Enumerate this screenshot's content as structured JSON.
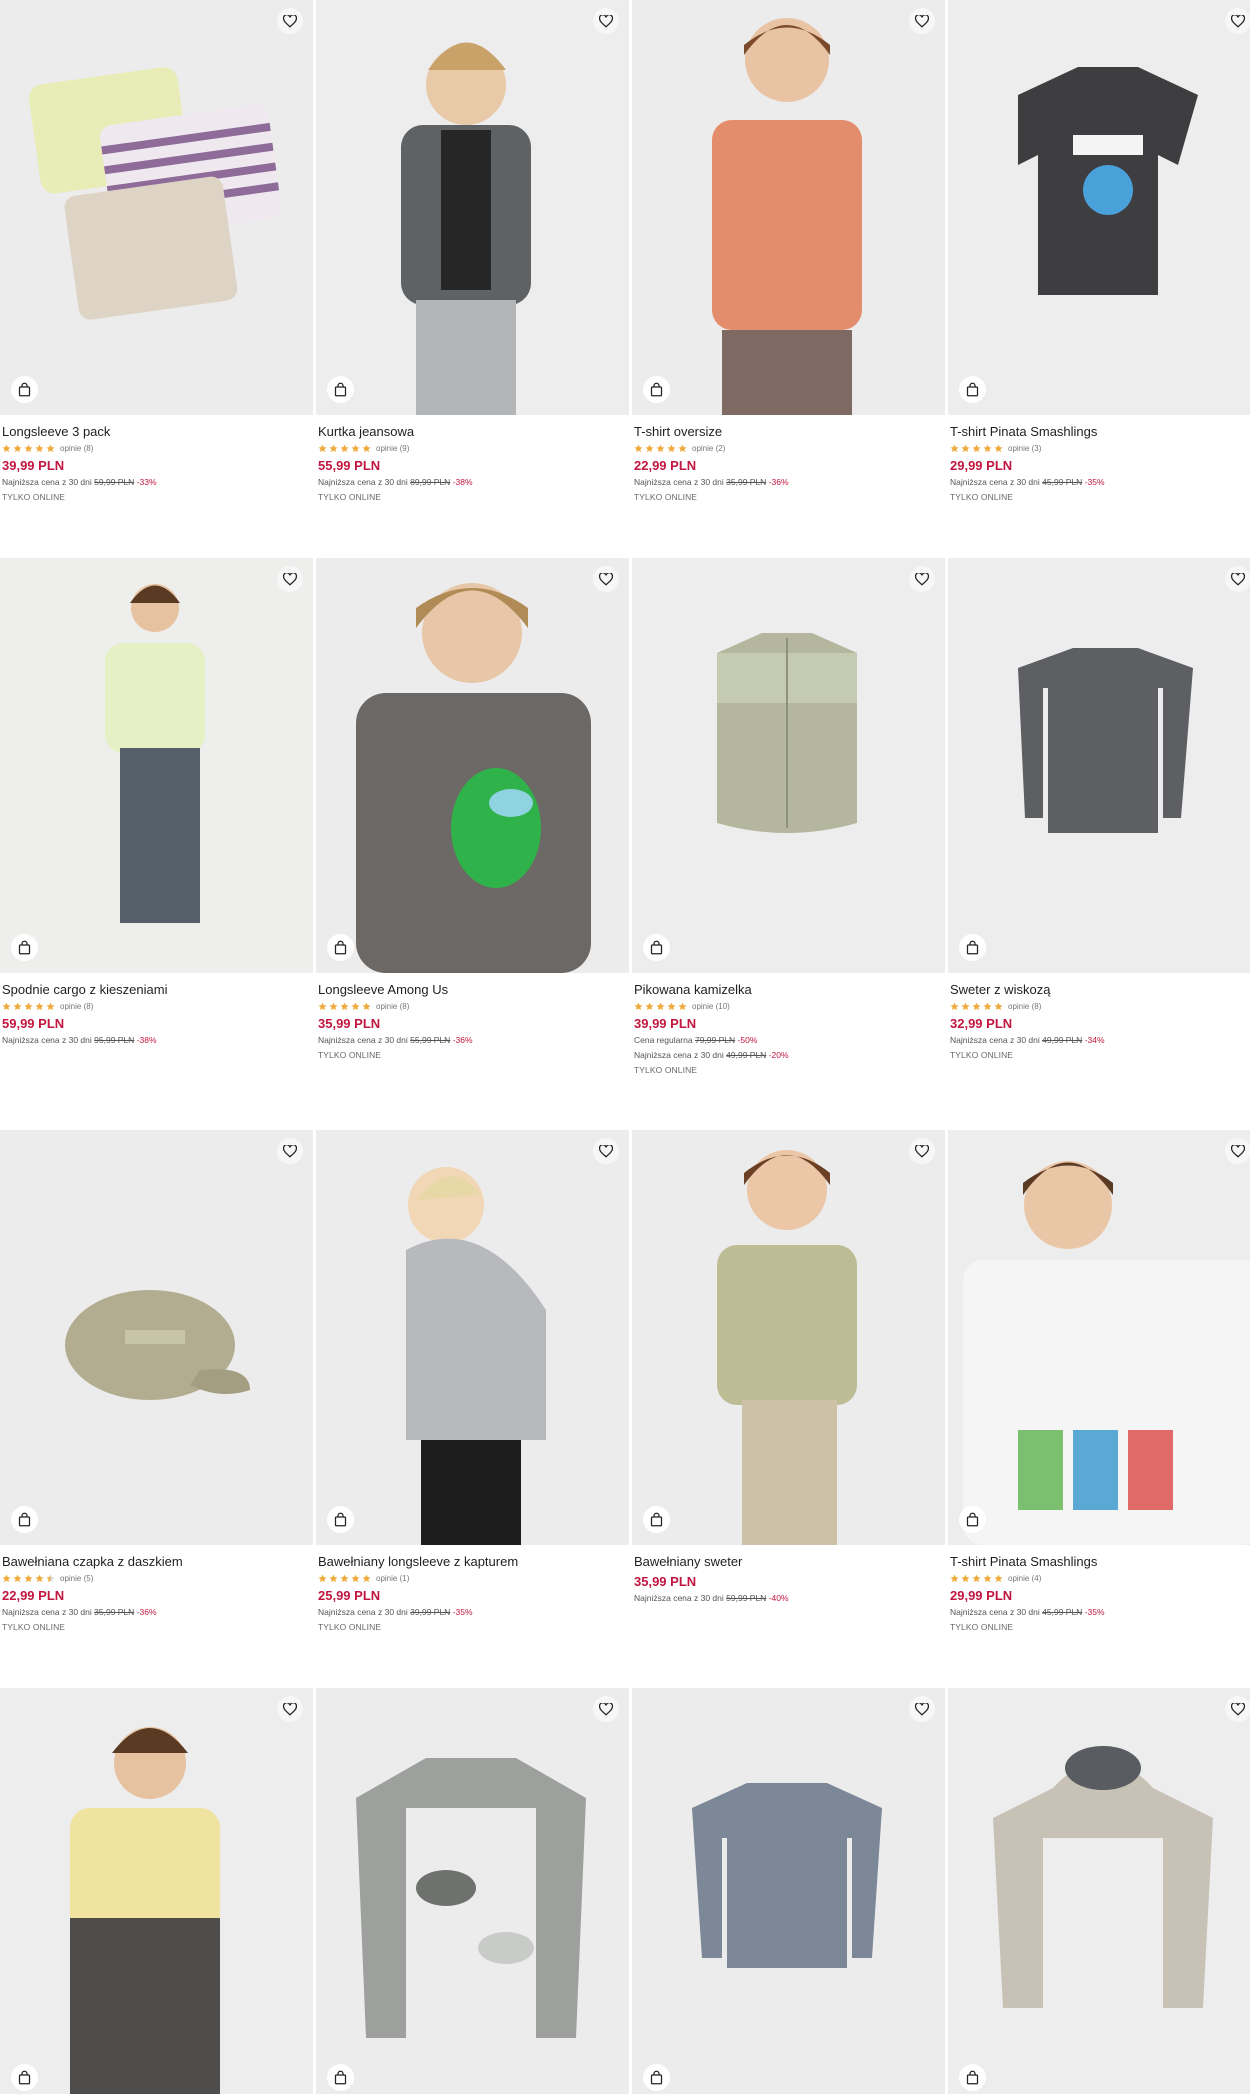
{
  "colors": {
    "price": "#c1163f",
    "star": "#f0a93c",
    "image_bg": "#ededed"
  },
  "icons": {
    "favorite": "heart-icon",
    "add_to_cart": "shopping-bag-icon",
    "rating": "star-icon"
  },
  "products": [
    {
      "name": "Longsleeve 3 pack",
      "stars": 5,
      "reviews": "opinie (8)",
      "price": "39,99 PLN",
      "lowest_label": "Najniższa cena z 30 dni",
      "lowest_old": "59,99 PLN",
      "lowest_pct": "-33%",
      "online": "TYLKO ONLINE"
    },
    {
      "name": "Kurtka jeansowa",
      "stars": 5,
      "reviews": "opinie (9)",
      "price": "55,99 PLN",
      "lowest_label": "Najniższa cena z 30 dni",
      "lowest_old": "89,99 PLN",
      "lowest_pct": "-38%",
      "online": "TYLKO ONLINE"
    },
    {
      "name": "T-shirt oversize",
      "stars": 5,
      "reviews": "opinie (2)",
      "price": "22,99 PLN",
      "lowest_label": "Najniższa cena z 30 dni",
      "lowest_old": "35,99 PLN",
      "lowest_pct": "-36%",
      "online": "TYLKO ONLINE"
    },
    {
      "name": "T-shirt Pinata Smashlings",
      "stars": 5,
      "reviews": "opinie (3)",
      "price": "29,99 PLN",
      "lowest_label": "Najniższa cena z 30 dni",
      "lowest_old": "45,99 PLN",
      "lowest_pct": "-35%",
      "online": "TYLKO ONLINE"
    },
    {
      "name": "Spodnie cargo z kieszeniami",
      "stars": 5,
      "reviews": "opinie (8)",
      "price": "59,99 PLN",
      "lowest_label": "Najniższa cena z 30 dni",
      "lowest_old": "95,99 PLN",
      "lowest_pct": "-38%",
      "online": ""
    },
    {
      "name": "Longsleeve Among Us",
      "stars": 5,
      "reviews": "opinie (8)",
      "price": "35,99 PLN",
      "lowest_label": "Najniższa cena z 30 dni",
      "lowest_old": "55,99 PLN",
      "lowest_pct": "-36%",
      "online": "TYLKO ONLINE"
    },
    {
      "name": "Pikowana kamizelka",
      "stars": 5,
      "reviews": "opinie (10)",
      "price": "39,99 PLN",
      "regular_label": "Cena regularna",
      "regular_old": "79,99 PLN",
      "regular_pct": "-50%",
      "lowest_label": "Najniższa cena z 30 dni",
      "lowest_old": "49,99 PLN",
      "lowest_pct": "-20%",
      "online": "TYLKO ONLINE"
    },
    {
      "name": "Sweter z wiskozą",
      "stars": 5,
      "reviews": "opinie (8)",
      "price": "32,99 PLN",
      "lowest_label": "Najniższa cena z 30 dni",
      "lowest_old": "49,99 PLN",
      "lowest_pct": "-34%",
      "online": "TYLKO ONLINE"
    },
    {
      "name": "Bawełniana czapka z daszkiem",
      "stars": 4.5,
      "reviews": "opinie (5)",
      "price": "22,99 PLN",
      "lowest_label": "Najniższa cena z 30 dni",
      "lowest_old": "35,99 PLN",
      "lowest_pct": "-36%",
      "online": "TYLKO ONLINE"
    },
    {
      "name": "Bawełniany longsleeve z kapturem",
      "stars": 5,
      "reviews": "opinie (1)",
      "price": "25,99 PLN",
      "lowest_label": "Najniższa cena z 30 dni",
      "lowest_old": "39,99 PLN",
      "lowest_pct": "-35%",
      "online": "TYLKO ONLINE"
    },
    {
      "name": "Bawełniany sweter",
      "stars": 0,
      "reviews": "",
      "price": "35,99 PLN",
      "lowest_label": "Najniższa cena z 30 dni",
      "lowest_old": "59,99 PLN",
      "lowest_pct": "-40%",
      "online": ""
    },
    {
      "name": "T-shirt Pinata Smashlings",
      "stars": 5,
      "reviews": "opinie (4)",
      "price": "29,99 PLN",
      "lowest_label": "Najniższa cena z 30 dni",
      "lowest_old": "45,99 PLN",
      "lowest_pct": "-35%",
      "online": "TYLKO ONLINE"
    },
    {
      "name": "",
      "stars": 0,
      "reviews": "",
      "price": "",
      "lowest_label": "",
      "lowest_old": "",
      "lowest_pct": "",
      "online": ""
    },
    {
      "name": "",
      "stars": 0,
      "reviews": "",
      "price": "",
      "lowest_label": "",
      "lowest_old": "",
      "lowest_pct": "",
      "online": ""
    },
    {
      "name": "",
      "stars": 0,
      "reviews": "",
      "price": "",
      "lowest_label": "",
      "lowest_old": "",
      "lowest_pct": "",
      "online": ""
    },
    {
      "name": "",
      "stars": 0,
      "reviews": "",
      "price": "",
      "lowest_label": "",
      "lowest_old": "",
      "lowest_pct": "",
      "online": ""
    }
  ]
}
